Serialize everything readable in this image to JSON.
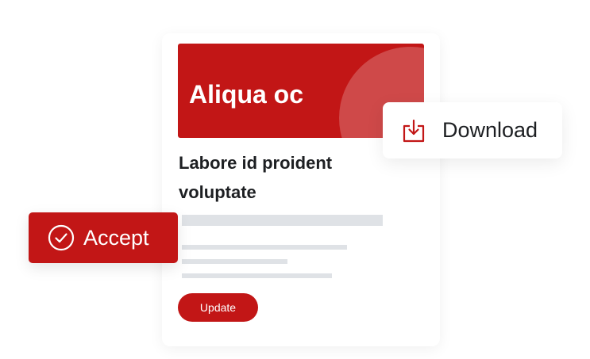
{
  "card": {
    "hero_title": "Aliqua oc",
    "subtitle": "Labore id proident voluptate",
    "update_label": "Update"
  },
  "accept": {
    "label": "Accept",
    "icon": "check-circle-icon"
  },
  "download": {
    "label": "Download",
    "icon": "download-tray-icon"
  },
  "colors": {
    "accent": "#c21616",
    "placeholder": "#dfe2e6",
    "text": "#1d1f22"
  }
}
